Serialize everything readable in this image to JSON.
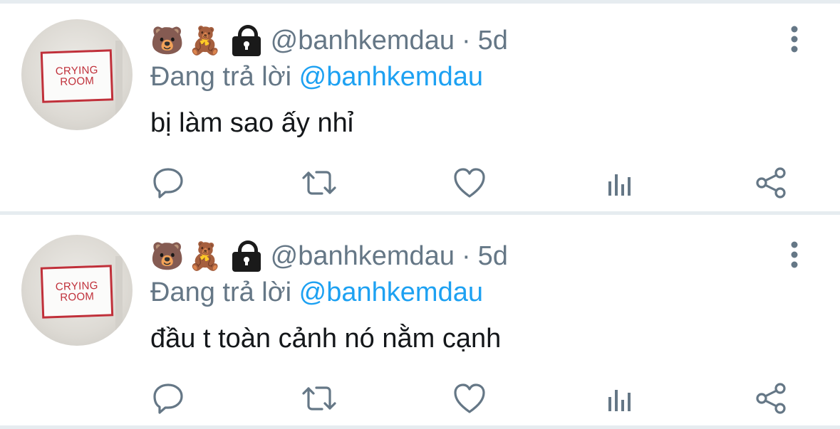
{
  "colors": {
    "secondary_text": "#657786",
    "primary_text": "#14171a",
    "mention": "#1da1f2",
    "divider": "#e6ecf0",
    "icon": "#657786"
  },
  "tweets": [
    {
      "avatar": {
        "sign_line1": "CRYING",
        "sign_line2": "ROOM"
      },
      "name_emoji": [
        "🐻",
        "🧸"
      ],
      "lock_icon": "lock-icon",
      "handle": "@banhkemdau",
      "separator": "·",
      "time": "5d",
      "reply_prefix": "Đang trả lời",
      "reply_to": "@banhkemdau",
      "text": "bị làm sao ấy nhỉ",
      "actions": [
        "reply-icon",
        "retweet-icon",
        "like-icon",
        "analytics-icon",
        "share-icon"
      ],
      "more_icon": "more-vertical-icon"
    },
    {
      "avatar": {
        "sign_line1": "CRYING",
        "sign_line2": "ROOM"
      },
      "name_emoji": [
        "🐻",
        "🧸"
      ],
      "lock_icon": "lock-icon",
      "handle": "@banhkemdau",
      "separator": "·",
      "time": "5d",
      "reply_prefix": "Đang trả lời",
      "reply_to": "@banhkemdau",
      "text": "đầu t toàn cảnh nó nằm cạnh",
      "actions": [
        "reply-icon",
        "retweet-icon",
        "like-icon",
        "analytics-icon",
        "share-icon"
      ],
      "more_icon": "more-vertical-icon"
    }
  ]
}
